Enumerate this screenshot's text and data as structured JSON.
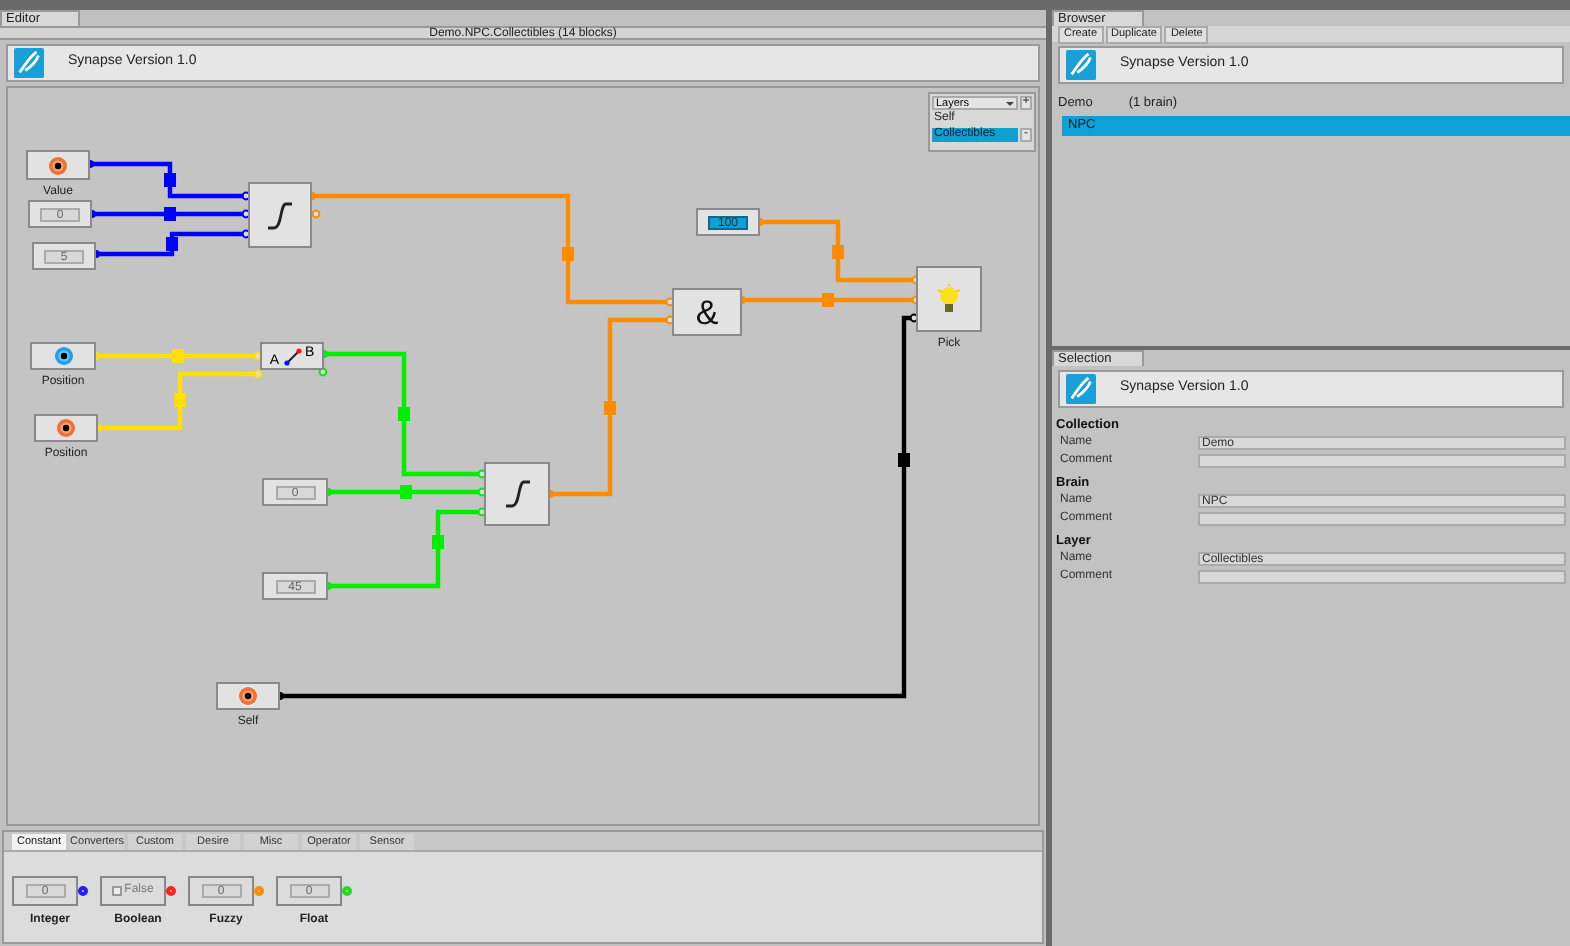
{
  "editor": {
    "tab": "Editor",
    "title": "Demo.NPC.Collectibles  (14 blocks)",
    "banner": "Synapse Version 1.0",
    "layers": {
      "title": "Layers",
      "add": "+",
      "remove": "-",
      "items": [
        {
          "label": "Self",
          "selected": false
        },
        {
          "label": "Collectibles",
          "selected": true
        }
      ]
    },
    "nodes": [
      {
        "kind": "input",
        "label": "Value",
        "color": "#f07030"
      },
      {
        "kind": "constant",
        "value": "0",
        "focused": false
      },
      {
        "kind": "constant",
        "value": "5",
        "focused": false
      },
      {
        "kind": "ramp"
      },
      {
        "kind": "input",
        "label": "Position",
        "color": "#20a0e8"
      },
      {
        "kind": "input",
        "label": "Position",
        "color": "#f07030"
      },
      {
        "kind": "switch",
        "a": "A",
        "b": "B"
      },
      {
        "kind": "constant",
        "value": "0",
        "focused": false
      },
      {
        "kind": "constant",
        "value": "45",
        "focused": false
      },
      {
        "kind": "ramp"
      },
      {
        "kind": "and",
        "symbol": "&"
      },
      {
        "kind": "constant",
        "value": "100",
        "focused": true
      },
      {
        "kind": "light",
        "label": "Pick"
      },
      {
        "kind": "input",
        "label": "Self",
        "color": "#f07030"
      }
    ],
    "wires": [
      {
        "color": "#0000ff"
      },
      {
        "color": "#0000ff"
      },
      {
        "color": "#0000ff"
      },
      {
        "color": "#ff8c00"
      },
      {
        "color": "#ff8c00"
      },
      {
        "color": "#ff8c00"
      },
      {
        "color": "#ff8c00"
      },
      {
        "color": "#ffe000"
      },
      {
        "color": "#ffe000"
      },
      {
        "color": "#00ee00"
      },
      {
        "color": "#00ee00"
      },
      {
        "color": "#00ee00"
      },
      {
        "color": "#000000"
      }
    ],
    "palette": {
      "tabs": [
        {
          "label": "Constant",
          "selected": true
        },
        {
          "label": "Converters",
          "selected": false
        },
        {
          "label": "Custom",
          "selected": false
        },
        {
          "label": "Desire",
          "selected": false
        },
        {
          "label": "Misc",
          "selected": false
        },
        {
          "label": "Operator",
          "selected": false
        },
        {
          "label": "Sensor",
          "selected": false
        }
      ],
      "items": [
        {
          "kind": "number",
          "label": "Integer",
          "value": "0",
          "color": "#2020ff"
        },
        {
          "kind": "checkbox",
          "label": "Boolean",
          "value": "False",
          "color": "#ff2020"
        },
        {
          "kind": "number",
          "label": "Fuzzy",
          "value": "0",
          "color": "#ff8c00"
        },
        {
          "kind": "number",
          "label": "Float",
          "value": "0",
          "color": "#20dd20"
        }
      ]
    }
  },
  "browser": {
    "tab": "Browser",
    "buttons": [
      "Create",
      "Duplicate",
      "Delete"
    ],
    "banner": "Synapse Version 1.0",
    "collection": "Demo",
    "count": "(1 brain)",
    "items": [
      {
        "label": "NPC",
        "selected": true
      }
    ]
  },
  "selection": {
    "tab": "Selection",
    "banner": "Synapse Version 1.0",
    "sections": [
      {
        "title": "Collection",
        "fields": [
          {
            "label": "Name",
            "value": "Demo"
          },
          {
            "label": "Comment"
          }
        ]
      },
      {
        "title": "Brain",
        "fields": [
          {
            "label": "Name",
            "value": "NPC"
          },
          {
            "label": "Comment"
          }
        ]
      },
      {
        "title": "Layer",
        "fields": [
          {
            "label": "Name",
            "value": "Collectibles"
          },
          {
            "label": "Comment"
          }
        ]
      }
    ]
  }
}
